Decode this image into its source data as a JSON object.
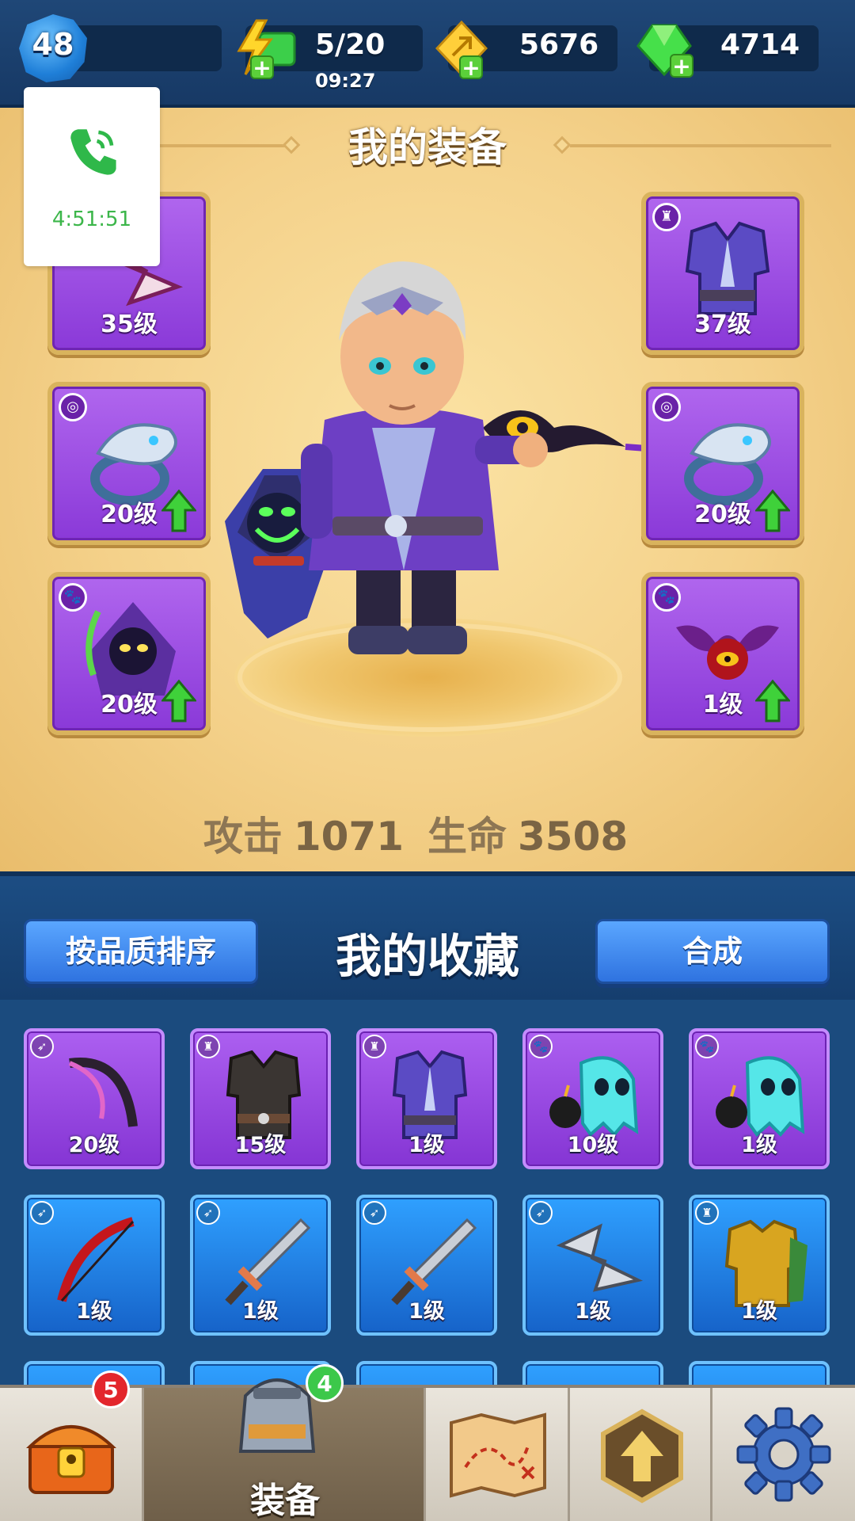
{
  "topbar": {
    "player_level": "48",
    "energy": "5/20",
    "energy_timer": "09:27",
    "coins": "5676",
    "gems": "4714"
  },
  "call_overlay": {
    "duration": "4:51:51",
    "icon": "phone-icon"
  },
  "equipment": {
    "title": "我的装备",
    "left_slots": [
      {
        "level": "35级",
        "icon": "shuriken-icon",
        "type_icon": "bow-type-icon",
        "upgrade": false
      },
      {
        "level": "20级",
        "icon": "dragon-ring-icon",
        "type_icon": "ring-type-icon",
        "upgrade": true
      },
      {
        "level": "20级",
        "icon": "reaper-pet-icon",
        "type_icon": "paw-type-icon",
        "upgrade": true
      }
    ],
    "right_slots": [
      {
        "level": "37级",
        "icon": "purple-armor-icon",
        "type_icon": "armor-type-icon",
        "upgrade": false
      },
      {
        "level": "20级",
        "icon": "dragon-ring-icon",
        "type_icon": "ring-type-icon",
        "upgrade": true
      },
      {
        "level": "1级",
        "icon": "bat-eye-pet-icon",
        "type_icon": "paw-type-icon",
        "upgrade": true
      }
    ],
    "stats": {
      "attack_label": "攻击",
      "attack_value": "1071",
      "hp_label": "生命",
      "hp_value": "3508"
    }
  },
  "collection": {
    "title": "我的收藏",
    "sort_button": "按品质排序",
    "merge_button": "合成",
    "row1": [
      {
        "level": "20级",
        "icon": "scythe-bow-icon",
        "type_icon": "bow-type-icon",
        "rarity": "purple"
      },
      {
        "level": "15级",
        "icon": "dark-vest-icon",
        "type_icon": "armor-type-icon",
        "rarity": "purple"
      },
      {
        "level": "1级",
        "icon": "purple-armor-icon",
        "type_icon": "armor-type-icon",
        "rarity": "purple"
      },
      {
        "level": "10级",
        "icon": "bomb-ghost-icon",
        "type_icon": "paw-type-icon",
        "rarity": "purple"
      },
      {
        "level": "1级",
        "icon": "bomb-ghost-icon",
        "type_icon": "paw-type-icon",
        "rarity": "purple"
      }
    ],
    "row2": [
      {
        "level": "1级",
        "icon": "red-bow-icon",
        "type_icon": "bow-type-icon",
        "rarity": "blue"
      },
      {
        "level": "1级",
        "icon": "sword-icon",
        "type_icon": "bow-type-icon",
        "rarity": "blue"
      },
      {
        "level": "1级",
        "icon": "sword-icon",
        "type_icon": "bow-type-icon",
        "rarity": "blue"
      },
      {
        "level": "1级",
        "icon": "shuriken-icon",
        "type_icon": "bow-type-icon",
        "rarity": "blue"
      },
      {
        "level": "1级",
        "icon": "gold-armor-icon",
        "type_icon": "armor-type-icon",
        "rarity": "blue"
      }
    ]
  },
  "bottom_nav": {
    "chest_badge": "5",
    "equip_badge": "4",
    "equip_label": "装备",
    "tabs": [
      "chest-icon",
      "armor-helmet-icon",
      "map-icon",
      "upgrade-icon",
      "gear-icon"
    ]
  },
  "colors": {
    "panel_bg": "#f4d18a",
    "epic_purple": "#8a39d8",
    "rare_blue": "#1663c9",
    "button_blue": "#2f73e0",
    "upgrade_green": "#3fd13a",
    "badge_red": "#e3262c",
    "badge_green": "#3cc84a"
  }
}
